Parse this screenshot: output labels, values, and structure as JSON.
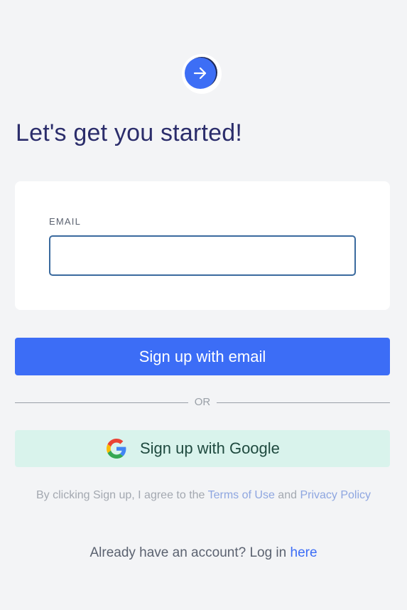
{
  "logo": {
    "icon": "arrow-right-icon",
    "color": "#3d6ef5"
  },
  "heading": "Let's get you started!",
  "form": {
    "email_label": "EMAIL",
    "email_value": "",
    "email_placeholder": ""
  },
  "buttons": {
    "email_signup": "Sign up with email",
    "google_signup": "Sign up with Google"
  },
  "divider_text": "OR",
  "legal": {
    "prefix": "By clicking Sign up, I agree to the ",
    "terms_link": "Terms of Use",
    "conjunction": " and ",
    "privacy_link": "Privacy Policy"
  },
  "login": {
    "prefix": "Already have an account? Log in ",
    "link": "here"
  },
  "colors": {
    "accent": "#3c6df6",
    "heading": "#2b2d6b",
    "google_bg": "#d9f3ec",
    "page_bg": "#f3f4f6"
  }
}
